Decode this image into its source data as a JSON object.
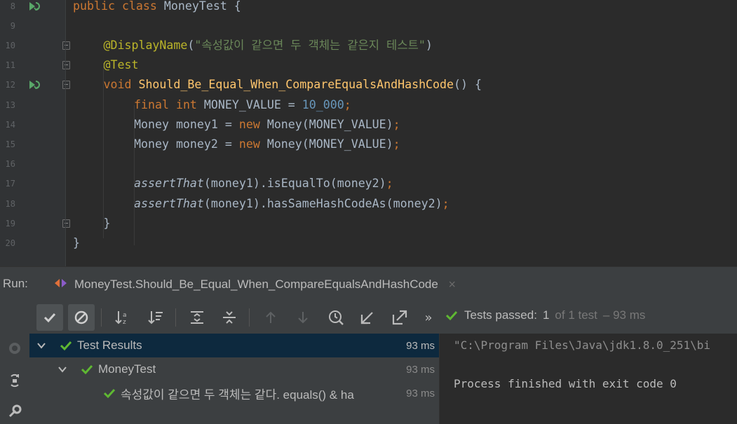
{
  "editor": {
    "line_numbers": [
      "8",
      "9",
      "10",
      "11",
      "12",
      "13",
      "14",
      "15",
      "16",
      "17",
      "18",
      "19",
      "20"
    ],
    "lines": [
      {
        "num": "8",
        "segments": [
          [
            "kw",
            "public "
          ],
          [
            "kw",
            "class "
          ],
          [
            "",
            "MoneyTest {"
          ]
        ]
      },
      {
        "num": "9",
        "segments": []
      },
      {
        "num": "10",
        "segments": [
          [
            "an",
            "@DisplayName"
          ],
          [
            "",
            "("
          ],
          [
            "st",
            "\"속성값이 같으면 두 객체는 같은지 테스트\""
          ],
          [
            "",
            ")"
          ]
        ]
      },
      {
        "num": "11",
        "segments": [
          [
            "an",
            "@Test"
          ]
        ]
      },
      {
        "num": "12",
        "segments": [
          [
            "kw",
            "void "
          ],
          [
            "fn",
            "Should_Be_Equal_When_CompareEqualsAndHashCode"
          ],
          [
            "",
            "() {"
          ]
        ]
      },
      {
        "num": "13",
        "segments": [
          [
            "kw",
            "final "
          ],
          [
            "kw",
            "int "
          ],
          [
            "",
            "MONEY_VALUE = "
          ],
          [
            "nu",
            "10_000"
          ],
          [
            "kw",
            ";"
          ]
        ]
      },
      {
        "num": "14",
        "segments": [
          [
            "",
            "Money money1 = "
          ],
          [
            "kw",
            "new "
          ],
          [
            "",
            "Money(MONEY_VALUE)"
          ],
          [
            "kw",
            ";"
          ]
        ]
      },
      {
        "num": "15",
        "segments": [
          [
            "",
            "Money money2 = "
          ],
          [
            "kw",
            "new "
          ],
          [
            "",
            "Money(MONEY_VALUE)"
          ],
          [
            "kw",
            ";"
          ]
        ]
      },
      {
        "num": "16",
        "segments": []
      },
      {
        "num": "17",
        "segments": [
          [
            "it",
            "assertThat"
          ],
          [
            "",
            "(money1).isEqualTo(money2)"
          ],
          [
            "kw",
            ";"
          ]
        ]
      },
      {
        "num": "18",
        "segments": [
          [
            "it",
            "assertThat"
          ],
          [
            "",
            "(money1).hasSameHashCodeAs(money2)"
          ],
          [
            "kw",
            ";"
          ]
        ]
      },
      {
        "num": "19",
        "segments": [
          [
            "",
            "}"
          ]
        ]
      },
      {
        "num": "20",
        "segments": [
          [
            "",
            "}"
          ]
        ]
      }
    ]
  },
  "run_window": {
    "label": "Run:",
    "tab_label": "MoneyTest.Should_Be_Equal_When_CompareEqualsAndHashCode",
    "tab_close": "×",
    "more": "»",
    "status": {
      "text_main": "Tests passed:",
      "count": "1",
      "of_text": "of 1 test",
      "time": "– 93 ms"
    }
  },
  "tree": {
    "rows": [
      {
        "label": "Test Results",
        "time": "93 ms"
      },
      {
        "label": "MoneyTest",
        "time": "93 ms"
      },
      {
        "label": "속성값이 같으면 두 객체는 같다. equals() & ha",
        "time": "93 ms"
      }
    ]
  },
  "console": {
    "cmd": "\"C:\\Program Files\\Java\\jdk1.8.0_251\\bi",
    "finished": "Process finished with exit code 0"
  },
  "colors": {
    "keyword": "#cc7832",
    "annotation": "#bbb529",
    "string": "#6a8759",
    "number": "#6897bb",
    "method": "#ffc66d",
    "pass_green": "#5fb832",
    "selected_row": "#0d293e"
  }
}
